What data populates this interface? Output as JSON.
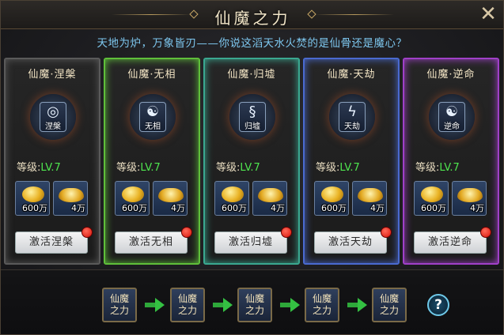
{
  "title": "仙魔之力",
  "close_icon": "close-icon",
  "subtitle": "天地为炉，万象皆刃——你说这滔天水火焚的是仙骨还是魔心？",
  "level_label": "等级:",
  "cards": [
    {
      "name": "仙魔·涅槃",
      "emblem_label": "涅槃",
      "emblem_icon": "swirl-icon",
      "level": "LV.7",
      "gold_qty": "600万",
      "ingot_qty": "4万",
      "button": "激活涅槃",
      "border_color": "#5a5a5a"
    },
    {
      "name": "仙魔·无相",
      "emblem_label": "无相",
      "emblem_icon": "swirl-icon",
      "level": "LV.7",
      "gold_qty": "600万",
      "ingot_qty": "4万",
      "button": "激活无相",
      "border_color": "#5fbf3a"
    },
    {
      "name": "仙魔·归墟",
      "emblem_label": "归墟",
      "emblem_icon": "dragon-icon",
      "level": "LV.7",
      "gold_qty": "600万",
      "ingot_qty": "4万",
      "button": "激活归墟",
      "border_color": "#3aa890"
    },
    {
      "name": "仙魔·天劫",
      "emblem_label": "天劫",
      "emblem_icon": "lightning-icon",
      "level": "LV.7",
      "gold_qty": "600万",
      "ingot_qty": "4万",
      "button": "激活天劫",
      "border_color": "#4a6ad0"
    },
    {
      "name": "仙魔·逆命",
      "emblem_label": "逆命",
      "emblem_icon": "yinyang-icon",
      "level": "LV.7",
      "gold_qty": "600万",
      "ingot_qty": "4万",
      "button": "激活逆命",
      "border_color": "#a040c8"
    }
  ],
  "stages": [
    "仙魔之力",
    "仙魔之力",
    "仙魔之力",
    "仙魔之力",
    "仙魔之力"
  ],
  "stage_line1": "仙魔",
  "stage_line2": "之力",
  "help_label": "?"
}
